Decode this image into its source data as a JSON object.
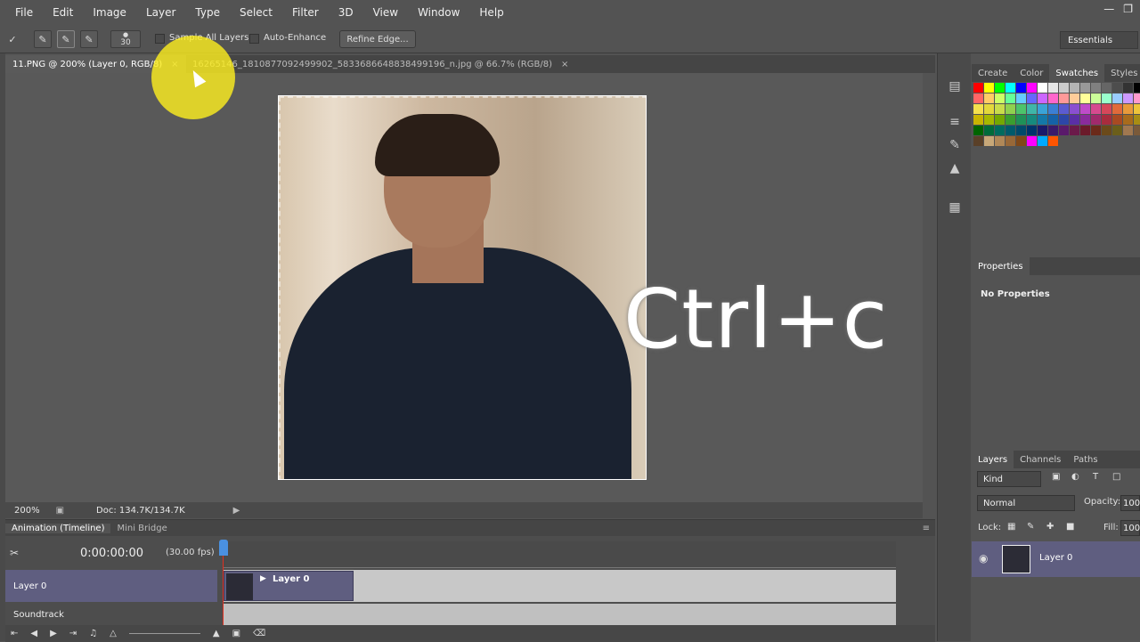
{
  "menubar": {
    "items": [
      "File",
      "Edit",
      "Image",
      "Layer",
      "Type",
      "Select",
      "Filter",
      "3D",
      "View",
      "Window",
      "Help"
    ]
  },
  "window_controls": [
    "minimize-icon",
    "restore-icon"
  ],
  "options_bar": {
    "brush_size": "30",
    "sample_all_layers": "Sample All Layers",
    "auto_enhance": "Auto-Enhance",
    "refine_edge": "Refine Edge...",
    "workspace": "Essentials"
  },
  "doc_tabs": [
    {
      "label": "11.PNG @ 200% (Layer 0, RGB/8)",
      "active": true
    },
    {
      "label": "16265146_1810877092499902_5833686648838499196_n.jpg @ 66.7% (RGB/8)",
      "active": false
    }
  ],
  "overlay_text": "Ctrl+c",
  "status_bar": {
    "zoom": "200%",
    "doc_size": "Doc: 134.7K/134.7K"
  },
  "timeline": {
    "tabs": [
      "Animation (Timeline)",
      "Mini Bridge"
    ],
    "timecode": "0:00:00:00",
    "fps": "(30.00 fps)",
    "layer_label": "Layer 0",
    "clip_label": "Layer 0",
    "soundtrack_label": "Soundtrack"
  },
  "right_panel": {
    "swatch_tabs": [
      "Create",
      "Color",
      "Swatches",
      "Styles"
    ],
    "swatch_active": "Swatches",
    "properties_tab": "Properties",
    "properties_text": "No Properties",
    "layer_tabs": [
      "Layers",
      "Channels",
      "Paths"
    ],
    "kind": "Kind",
    "blend_mode": "Normal",
    "opacity_label": "Opacity:",
    "opacity_value": "100",
    "lock_label": "Lock:",
    "fill_label": "Fill:",
    "fill_value": "100",
    "layer_name": "Layer 0"
  },
  "swatch_colors": [
    "#ff0000",
    "#ffff00",
    "#00ff00",
    "#00ffff",
    "#0000ff",
    "#ff00ff",
    "#ffffff",
    "#e6e6e6",
    "#cccccc",
    "#b3b3b3",
    "#999999",
    "#808080",
    "#666666",
    "#4d4d4d",
    "#333333",
    "#000000",
    "#ff6666",
    "#ffcc66",
    "#ccff66",
    "#66ff99",
    "#66ccff",
    "#6666ff",
    "#cc66ff",
    "#ff66cc",
    "#ff9999",
    "#ffcc99",
    "#ffff99",
    "#ccff99",
    "#99ffcc",
    "#99ccff",
    "#cc99ff",
    "#ff99cc",
    "#f4e04d",
    "#e3d83b",
    "#c9dc4a",
    "#8fd14f",
    "#4cc46b",
    "#3fb6a8",
    "#3aa3d7",
    "#3b7fd4",
    "#5b5bd1",
    "#8a4fd1",
    "#bf4bc9",
    "#d64a8f",
    "#d6475a",
    "#e06a3b",
    "#e89a3b",
    "#eec43b",
    "#c8b400",
    "#a6b800",
    "#74a800",
    "#3a9e2f",
    "#1f9158",
    "#168a7e",
    "#1478a8",
    "#1562a8",
    "#2d46a8",
    "#5a2fa6",
    "#8a2b9c",
    "#a02a6b",
    "#a82c3d",
    "#a84a22",
    "#a86b1c",
    "#a88d14",
    "#006400",
    "#006b3a",
    "#006b5e",
    "#005a6b",
    "#004a6b",
    "#00336b",
    "#1a1a6b",
    "#3a1a6b",
    "#5a1a6b",
    "#6b1a4a",
    "#6b1a2a",
    "#6b2a1a",
    "#6b4a1a",
    "#6b5e1a",
    "#a07850",
    "#7a5a3a",
    "#5a4028",
    "#c8a878",
    "#b08858",
    "#986838",
    "#804818",
    "#ff00ff",
    "#00aaff",
    "#ff5500"
  ]
}
